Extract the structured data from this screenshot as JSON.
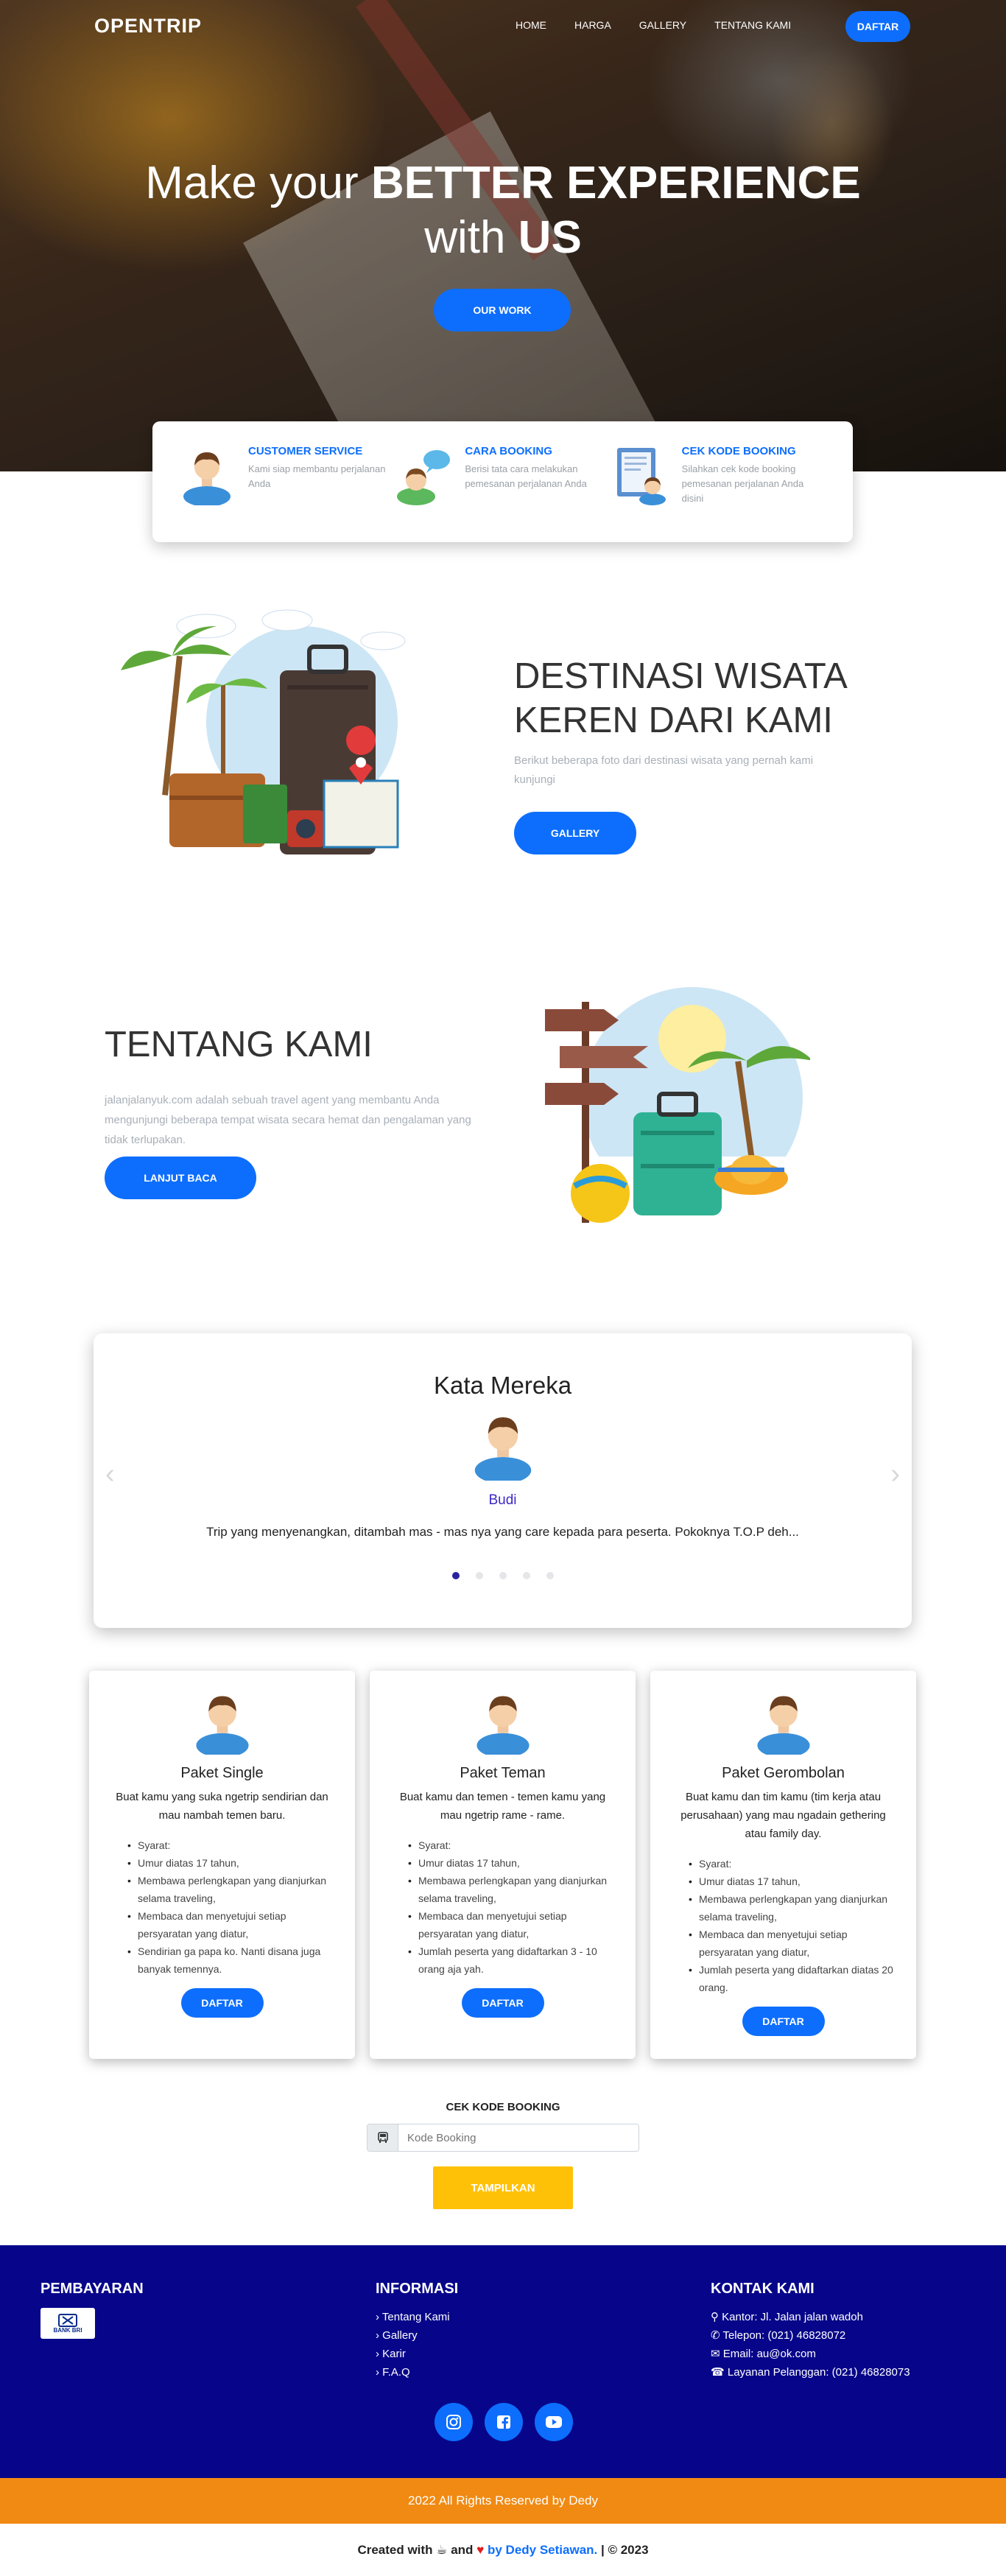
{
  "navbar": {
    "brand": "OPENTRIP",
    "links": [
      "HOME",
      "HARGA",
      "GALLERY",
      "TENTANG KAMI"
    ],
    "cta": "DAFTAR"
  },
  "hero": {
    "line1_light": "Make your ",
    "line1_bold": "BETTER EXPERIENCE",
    "line2_light": "with ",
    "line2_bold": "US",
    "button": "OUR WORK"
  },
  "features": [
    {
      "title": "CUSTOMER SERVICE",
      "text": "Kami siap membantu perjalanan Anda",
      "icon": "customer-service-icon"
    },
    {
      "title": "CARA BOOKING",
      "text": "Berisi tata cara melakukan pemesanan perjalanan Anda",
      "icon": "booking-chat-icon"
    },
    {
      "title": "CEK KODE BOOKING",
      "text": "Silahkan cek kode booking pemesanan perjalanan Anda disini",
      "icon": "booking-document-icon"
    }
  ],
  "destinasi": {
    "title_l1": "DESTINASI WISATA",
    "title_l2_bold1": "KEREN",
    "title_l2_light": " DARI ",
    "title_l2_bold2": "KAMI",
    "subtitle": "Berikut beberapa foto dari destinasi wisata yang pernah kami kunjungi",
    "button": "GALLERY"
  },
  "tentang": {
    "title": "TENTANG KAMI",
    "text": "jalanjalanyuk.com adalah sebuah travel agent yang membantu Anda mengunjungi beberapa tempat wisata secara hemat dan pengalaman yang tidak terlupakan.",
    "button": "LANJUT BACA"
  },
  "testimoni": {
    "title": "Kata Mereka",
    "name": "Budi",
    "quote": "Trip yang menyenangkan, ditambah mas - mas nya yang care kepada para peserta. Pokoknya T.O.P deh...",
    "dots": 5,
    "active_dot": 0
  },
  "paket": [
    {
      "title": "Paket Single",
      "desc": "Buat kamu yang suka ngetrip sendirian dan mau nambah temen baru.",
      "items": [
        "Syarat:",
        "Umur diatas 17 tahun,",
        "Membawa perlengkapan yang dianjurkan selama traveling,",
        "Membaca dan menyetujui setiap persyaratan yang diatur,",
        "Sendirian ga papa ko. Nanti disana juga banyak temennya."
      ],
      "button": "DAFTAR"
    },
    {
      "title": "Paket Teman",
      "desc": "Buat kamu dan temen - temen kamu yang mau ngetrip rame - rame.",
      "items": [
        "Syarat:",
        "Umur diatas 17 tahun,",
        "Membawa perlengkapan yang dianjurkan selama traveling,",
        "Membaca dan menyetujui setiap persyaratan yang diatur,",
        "Jumlah peserta yang didaftarkan 3 - 10 orang aja yah."
      ],
      "button": "DAFTAR"
    },
    {
      "title": "Paket Gerombolan",
      "desc": "Buat kamu dan tim kamu (tim kerja atau perusahaan) yang mau ngadain gethering atau family day.",
      "items": [
        "Syarat:",
        "Umur diatas 17 tahun,",
        "Membawa perlengkapan yang dianjurkan selama traveling,",
        "Membaca dan menyetujui setiap persyaratan yang diatur,",
        "Jumlah peserta yang didaftarkan diatas 20 orang."
      ],
      "button": "DAFTAR"
    }
  ],
  "cek_booking": {
    "title": "CEK KODE BOOKING",
    "placeholder": "Kode Booking",
    "button": "TAMPILKAN"
  },
  "footer": {
    "pembayaran": {
      "title": "PEMBAYARAN",
      "bank": "BANK BRI"
    },
    "informasi": {
      "title": "INFORMASI",
      "links": [
        "Tentang Kami",
        "Gallery",
        "Karir",
        "F.A.Q"
      ]
    },
    "kontak": {
      "title": "KONTAK KAMI",
      "items": [
        "Kantor: Jl. Jalan jalan wadoh",
        "Telepon: (021) 46828072",
        "Email: au@ok.com",
        "Layanan Pelanggan: (021) 46828073"
      ]
    },
    "socials": [
      "instagram-icon",
      "facebook-icon",
      "youtube-icon"
    ],
    "copyright": "2022 All Rights Reserved by Dedy",
    "credit_pre": "Created with",
    "credit_and": "and",
    "credit_by": "by Dedy Setiawan.",
    "credit_post": "| © 2023"
  },
  "colors": {
    "primary": "#0d6efd",
    "footer_bg": "#07068a",
    "copyright_bg": "#f08a13",
    "cta_yellow": "#ffc107"
  }
}
